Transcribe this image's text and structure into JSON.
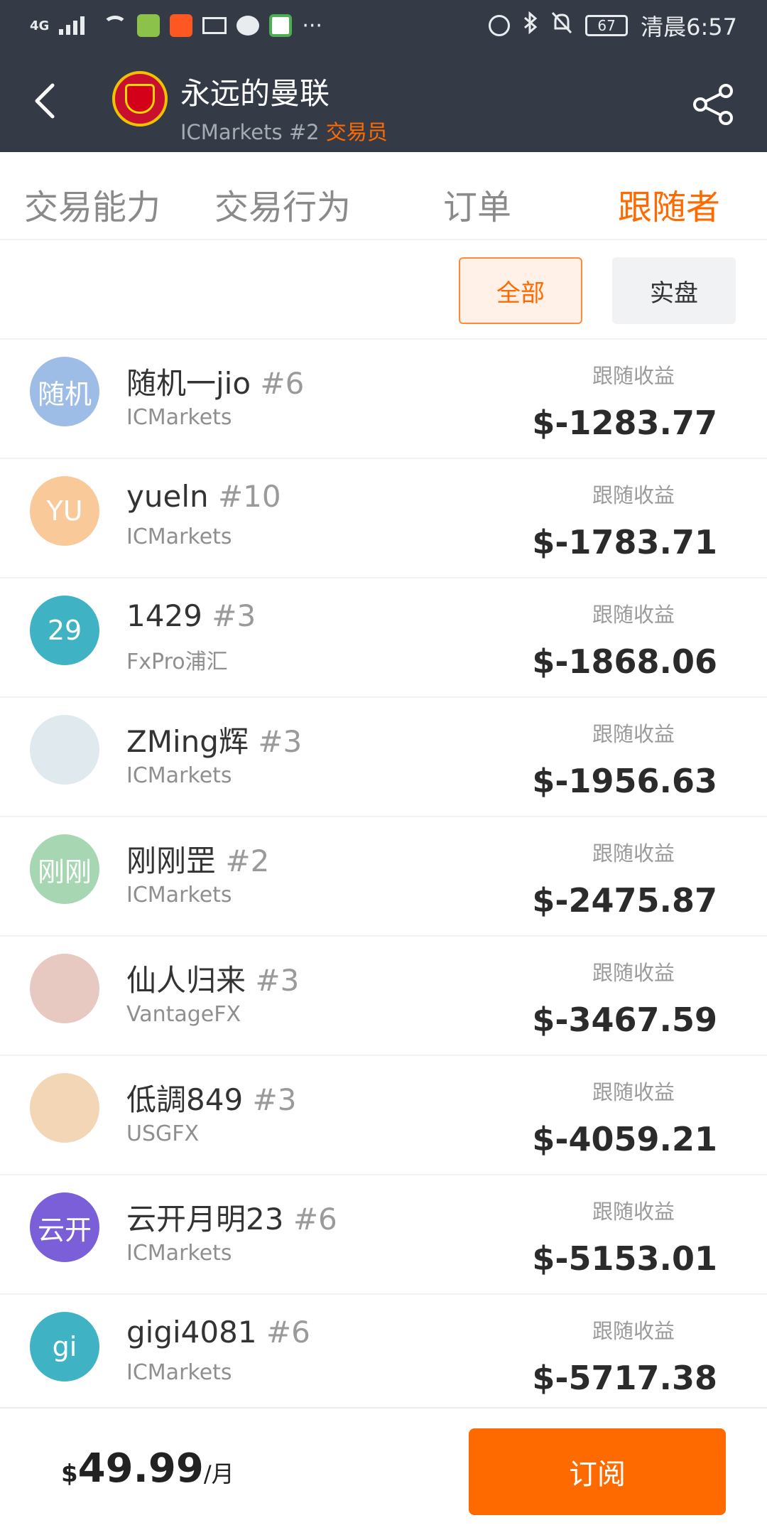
{
  "status_bar": {
    "network": "4G",
    "battery": "67",
    "time": "清晨6:57",
    "more": "···"
  },
  "header": {
    "title": "永远的曼联",
    "subtitle_prefix": "ICMarkets #2",
    "subtitle_role": "交易员"
  },
  "tabs": [
    {
      "label": "交易能力",
      "active": false
    },
    {
      "label": "交易行为",
      "active": false
    },
    {
      "label": "订单",
      "active": false
    },
    {
      "label": "跟随者",
      "active": true
    }
  ],
  "filters": [
    {
      "label": "全部",
      "active": true
    },
    {
      "label": "实盘",
      "active": false
    }
  ],
  "followers": [
    {
      "avatar_text": "随机",
      "avatar_color": "#9dbde6",
      "name": "随机一jio",
      "rank": "#6",
      "broker": "ICMarkets",
      "label": "跟随收益",
      "value": "$-1283.77"
    },
    {
      "avatar_text": "YU",
      "avatar_color": "#f9c99a",
      "name": "yueln",
      "rank": "#10",
      "broker": "ICMarkets",
      "label": "跟随收益",
      "value": "$-1783.71"
    },
    {
      "avatar_text": "29",
      "avatar_color": "#3fb3c3",
      "name": "1429",
      "rank": "#3",
      "broker": "FxPro浦汇",
      "label": "跟随收益",
      "value": "$-1868.06"
    },
    {
      "avatar_text": "",
      "avatar_color": "#dfe9ee",
      "name": "ZMing辉",
      "rank": "#3",
      "broker": "ICMarkets",
      "label": "跟随收益",
      "value": "$-1956.63"
    },
    {
      "avatar_text": "刚刚",
      "avatar_color": "#a6d7b2",
      "name": "刚刚罡",
      "rank": "#2",
      "broker": "ICMarkets",
      "label": "跟随收益",
      "value": "$-2475.87"
    },
    {
      "avatar_text": "",
      "avatar_color": "#e8c9c2",
      "name": "仙人归来",
      "rank": "#3",
      "broker": "VantageFX",
      "label": "跟随收益",
      "value": "$-3467.59"
    },
    {
      "avatar_text": "",
      "avatar_color": "#f3d6b6",
      "name": "低調849",
      "rank": "#3",
      "broker": "USGFX",
      "label": "跟随收益",
      "value": "$-4059.21"
    },
    {
      "avatar_text": "云开",
      "avatar_color": "#7b5fd8",
      "name": "云开月明23",
      "rank": "#6",
      "broker": "ICMarkets",
      "label": "跟随收益",
      "value": "$-5153.01"
    },
    {
      "avatar_text": "gi",
      "avatar_color": "#3fb3c3",
      "name": "gigi4081",
      "rank": "#6",
      "broker": "ICMarkets",
      "label": "跟随收益",
      "value": "$-5717.38"
    }
  ],
  "bottom": {
    "currency": "$",
    "price": "49.99",
    "unit": "/月",
    "subscribe_label": "订阅"
  },
  "colors": {
    "accent": "#ff6a00",
    "header_bg": "#353b46"
  }
}
